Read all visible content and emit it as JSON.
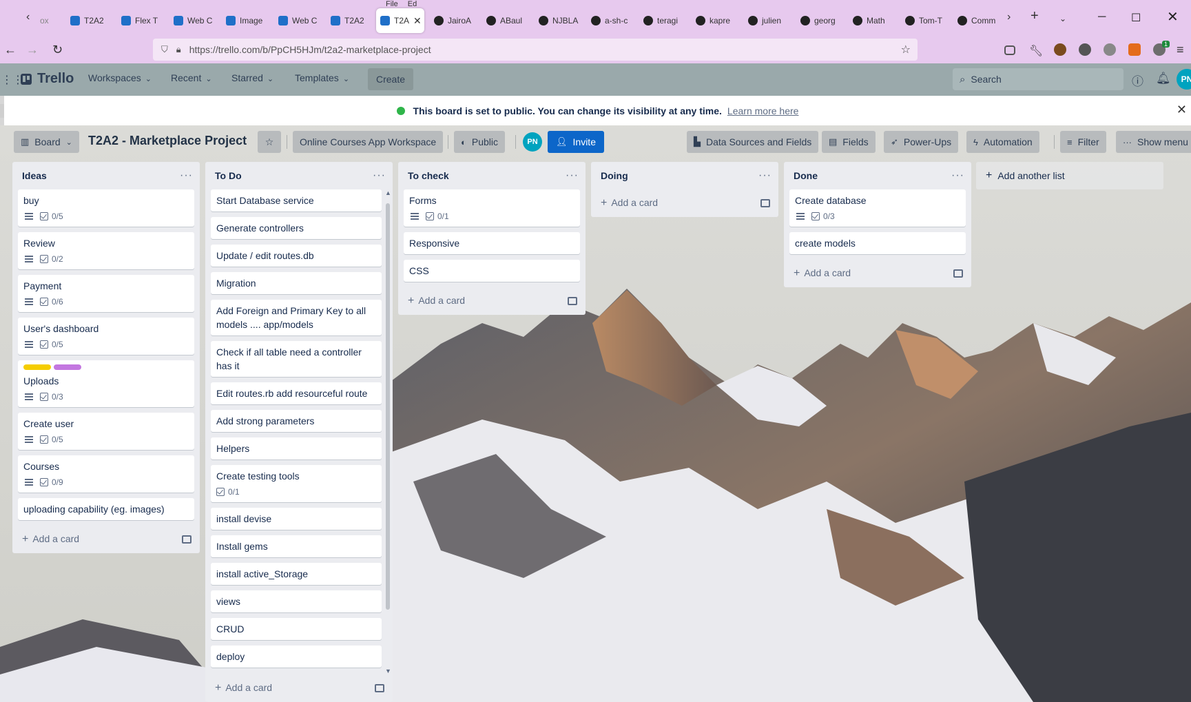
{
  "browser": {
    "menu_peek": [
      "File",
      "Ed"
    ],
    "tabs": [
      {
        "label": "T2A2",
        "icon": "trello-favicon"
      },
      {
        "label": "Flex T",
        "icon": "site-favicon"
      },
      {
        "label": "Web C",
        "icon": "site-favicon"
      },
      {
        "label": "Image",
        "icon": "site-favicon"
      },
      {
        "label": "Web C",
        "icon": "site-favicon"
      },
      {
        "label": "T2A2",
        "icon": "site-favicon"
      },
      {
        "label": "T2A",
        "icon": "trello-favicon",
        "active": true
      },
      {
        "label": "JairoA",
        "icon": "github-favicon"
      },
      {
        "label": "ABaul",
        "icon": "github-favicon"
      },
      {
        "label": "NJBLA",
        "icon": "github-favicon"
      },
      {
        "label": "a-sh-c",
        "icon": "github-favicon"
      },
      {
        "label": "teragi",
        "icon": "github-favicon"
      },
      {
        "label": "kapre",
        "icon": "github-favicon"
      },
      {
        "label": "julien",
        "icon": "github-favicon"
      },
      {
        "label": "georg",
        "icon": "github-favicon"
      },
      {
        "label": "Math",
        "icon": "github-favicon"
      },
      {
        "label": "Tom-T",
        "icon": "github-favicon"
      },
      {
        "label": "Comm",
        "icon": "github-favicon"
      }
    ],
    "first_tab_partial": "ox",
    "url": "https://trello.com/b/PpCH5HJm/t2a2-marketplace-project",
    "ext_badge": "1"
  },
  "trello": {
    "brand": "Trello",
    "menus": [
      "Workspaces",
      "Recent",
      "Starred",
      "Templates"
    ],
    "create_label": "Create",
    "search_placeholder": "Search",
    "user_initials": "PN"
  },
  "banner": {
    "message": "This board is set to public. You can change its visibility at any time.",
    "link": "Learn more here"
  },
  "board": {
    "view_label": "Board",
    "title": "T2A2 - Marketplace Project",
    "workspace": "Online Courses App Workspace",
    "visibility": "Public",
    "member_initials": "PN",
    "invite_label": "Invite",
    "data_sources": "Data Sources and Fields",
    "fields": "Fields",
    "power_ups": "Power-Ups",
    "automation": "Automation",
    "filter": "Filter",
    "show_menu": "Show menu",
    "add_list": "Add another list",
    "add_card": "Add a card",
    "lists": [
      {
        "title": "Ideas",
        "cards": [
          {
            "title": "buy",
            "desc": true,
            "checklist": "0/5"
          },
          {
            "title": "Review",
            "desc": true,
            "checklist": "0/2"
          },
          {
            "title": "Payment",
            "desc": true,
            "checklist": "0/6"
          },
          {
            "title": "User's dashboard",
            "desc": true,
            "checklist": "0/5"
          },
          {
            "title": "Uploads",
            "desc": true,
            "checklist": "0/3",
            "labels": [
              "#f5cd00",
              "#c377e0"
            ]
          },
          {
            "title": "Create user",
            "desc": true,
            "checklist": "0/5"
          },
          {
            "title": "Courses",
            "desc": true,
            "checklist": "0/9"
          },
          {
            "title": "uploading capability (eg. images)"
          }
        ]
      },
      {
        "title": "To Do",
        "cards": [
          {
            "title": "Start Database service"
          },
          {
            "title": "Generate controllers"
          },
          {
            "title": "Update / edit routes.db"
          },
          {
            "title": "Migration"
          },
          {
            "title": "Add Foreign and Primary Key to all models .... app/models"
          },
          {
            "title": "Check if all table need a controller has it"
          },
          {
            "title": "Edit routes.rb add resourceful route"
          },
          {
            "title": "Add strong parameters"
          },
          {
            "title": "Helpers"
          },
          {
            "title": "Create testing tools",
            "checklist": "0/1"
          },
          {
            "title": "install devise"
          },
          {
            "title": "Install gems"
          },
          {
            "title": "install active_Storage"
          },
          {
            "title": "views"
          },
          {
            "title": "CRUD"
          },
          {
            "title": "deploy"
          }
        ]
      },
      {
        "title": "To check",
        "cards": [
          {
            "title": "Forms",
            "desc": true,
            "checklist": "0/1"
          },
          {
            "title": "Responsive"
          },
          {
            "title": "CSS"
          }
        ]
      },
      {
        "title": "Doing",
        "cards": []
      },
      {
        "title": "Done",
        "cards": [
          {
            "title": "Create database",
            "desc": true,
            "checklist": "0/3"
          },
          {
            "title": "create models"
          }
        ]
      }
    ]
  },
  "colors": {
    "tabbar": "#e7c9ee",
    "trello_header": "#9aa9ab",
    "invite": "#0c66c9",
    "public_dot": "#2fb54a",
    "avatar": "#00a3bf"
  }
}
